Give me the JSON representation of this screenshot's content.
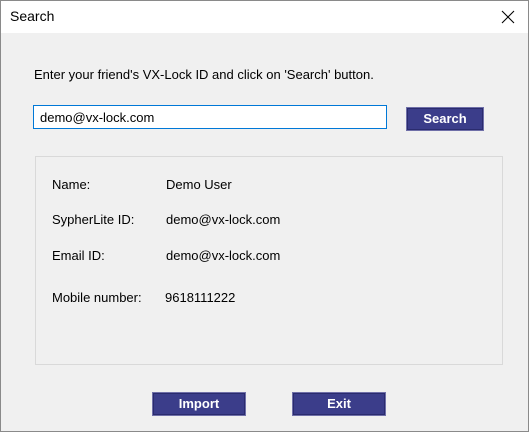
{
  "window": {
    "title": "Search"
  },
  "search": {
    "instruction": "Enter your friend's VX-Lock ID and click on 'Search' button.",
    "input_value": "demo@vx-lock.com",
    "search_button_label": "Search"
  },
  "details": {
    "name_label": "Name:",
    "name_value": "Demo User",
    "sypherlite_label": "SypherLite ID:",
    "sypherlite_value": "demo@vx-lock.com",
    "email_label": "Email ID:",
    "email_value": "demo@vx-lock.com",
    "mobile_label": "Mobile number:",
    "mobile_value": "9618111222"
  },
  "actions": {
    "import_label": "Import",
    "exit_label": "Exit"
  },
  "icons": {
    "close": "close-icon"
  },
  "colors": {
    "button_background": "#3b3d8a",
    "button_text": "#ffffff",
    "input_focus_border": "#0078d7",
    "dialog_background": "#f0f0f0"
  }
}
